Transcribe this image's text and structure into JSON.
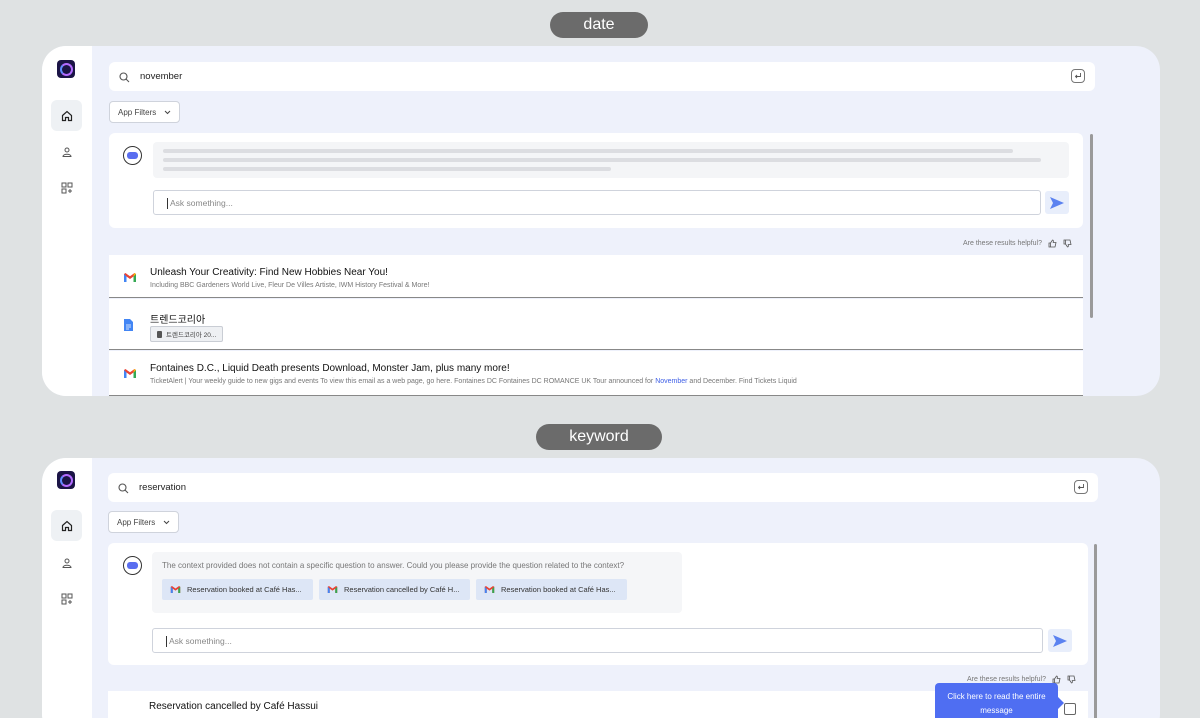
{
  "panel_top": {
    "label": "date",
    "search": {
      "value": "november"
    },
    "app_filters": "App Filters",
    "ask_placeholder": "Ask something...",
    "helpful": "Are these results helpful?",
    "results": [
      {
        "title": "Unleash Your Creativity: Find New Hobbies Near You!",
        "snippet": "Including BBC Gardeners World Live, Fleur De Villes Artiste, IWM History Festival & More!",
        "source": "gmail-icon"
      },
      {
        "title": "트렌드코리아",
        "attachment": "트렌드코리아 20...",
        "source": "google-docs-icon"
      },
      {
        "title": "Fontaines D.C., Liquid Death presents Download, Monster Jam, plus many more!",
        "snippet_pre": "TicketAlert | Your weekly guide to new gigs and events To view this email as a web page, go here. Fontaines DC Fontaines DC ROMANCE UK Tour announced for ",
        "snippet_highlight": "November",
        "snippet_post": " and December. Find Tickets Liquid",
        "source": "gmail-icon"
      }
    ]
  },
  "panel_bottom": {
    "label": "keyword",
    "search": {
      "value": "reservation"
    },
    "app_filters": "App Filters",
    "answer": "The context provided does not contain a specific question to answer. Could you please provide the question related to the context?",
    "chips": [
      "Reservation booked at Café Has...",
      "Reservation cancelled by Café H...",
      "Reservation booked at Café Has..."
    ],
    "ask_placeholder": "Ask something...",
    "helpful": "Are these results helpful?",
    "results": [
      {
        "title": "Reservation cancelled by Café Hassui"
      }
    ],
    "tooltip": "Click here to read the entire message"
  },
  "colors": {
    "accent": "#4f6ef2",
    "frame_bg": "#eef1fb",
    "page_bg": "#dfe2e3",
    "highlight": "#3d5ee6"
  }
}
